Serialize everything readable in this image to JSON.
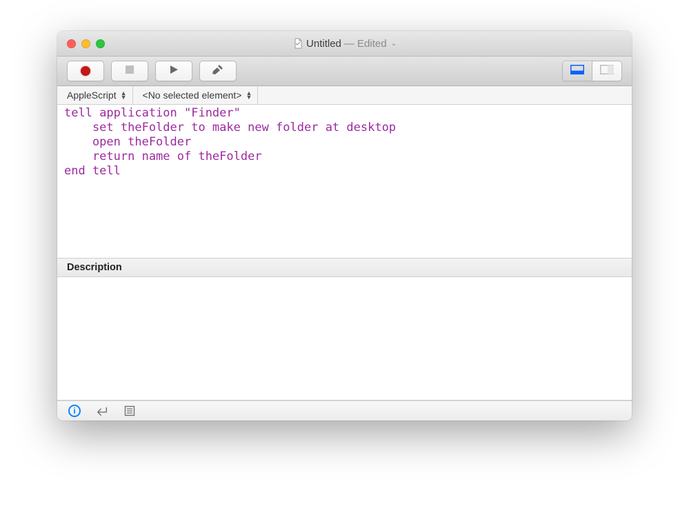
{
  "window": {
    "title": "Untitled",
    "edited_suffix": " — Edited"
  },
  "navbar": {
    "language": "AppleScript",
    "element": "<No selected element>"
  },
  "code": "tell application \"Finder\"\n    set theFolder to make new folder at desktop\n    open theFolder\n    return name of theFolder\nend tell",
  "description": {
    "header": "Description"
  },
  "icons": {
    "record": "record-icon",
    "stop": "stop-icon",
    "run": "run-icon",
    "build": "build-icon",
    "result_pane": "result-pane-icon",
    "log_pane": "log-pane-icon",
    "info": "info-icon",
    "return": "return-icon",
    "list": "list-icon",
    "document": "document-icon"
  }
}
